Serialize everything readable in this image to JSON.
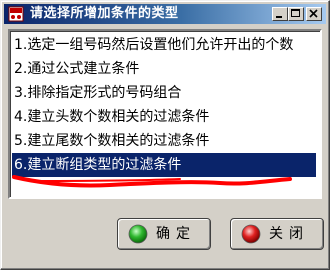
{
  "window": {
    "title": "请选择所增加条件的类型",
    "icon": "app-icon",
    "controls": [
      "minimize-icon",
      "maximize-icon",
      "close-icon"
    ]
  },
  "list": {
    "items": [
      "1.选定一组号码然后设置他们允许开出的个数",
      "2.通过公式建立条件",
      "3.排除指定形式的号码组合",
      "4.建立头数个数相关的过滤条件",
      "5.建立尾数个数相关的过滤条件",
      "6.建立断组类型的过滤条件"
    ],
    "selected_index": 5
  },
  "buttons": {
    "ok_label": "确定",
    "cancel_label": "关闭"
  },
  "colors": {
    "selection": "#0a246a",
    "annotation": "#ff0000",
    "ok_icon": "#2fb82f",
    "cancel_icon": "#e02020"
  }
}
